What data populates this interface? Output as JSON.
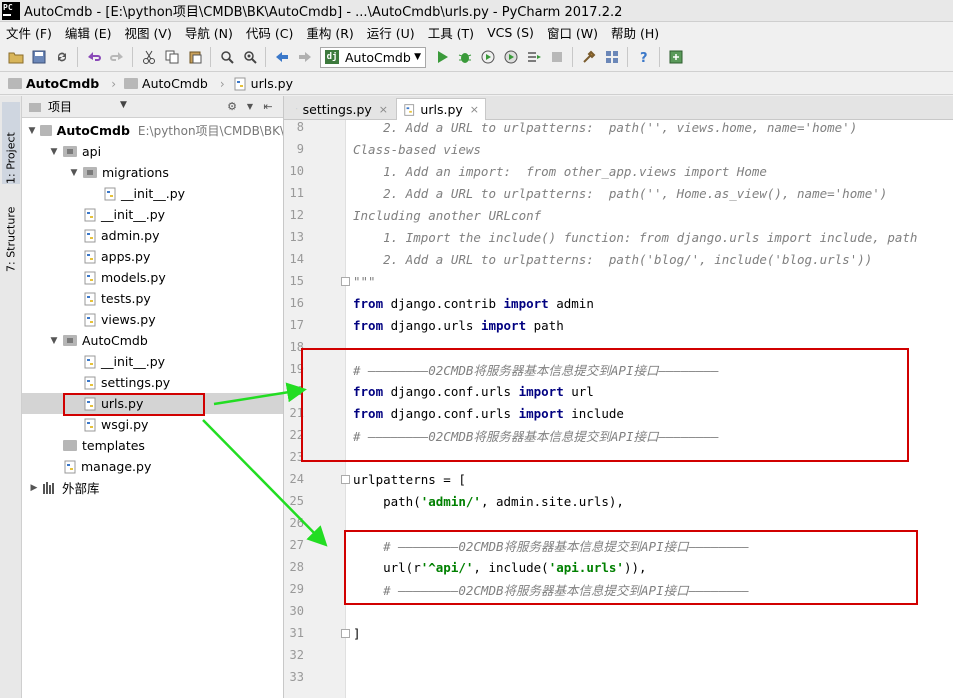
{
  "window": {
    "app_logo": "PC",
    "title": "AutoCmdb - [E:\\python项目\\CMDB\\BK\\AutoCmdb] - ...\\AutoCmdb\\urls.py - PyCharm 2017.2.2"
  },
  "menu": [
    "文件 (F)",
    "编辑 (E)",
    "视图 (V)",
    "导航 (N)",
    "代码 (C)",
    "重构 (R)",
    "运行 (U)",
    "工具 (T)",
    "VCS (S)",
    "窗口 (W)",
    "帮助 (H)"
  ],
  "toolbar": {
    "run_config": "AutoCmdb",
    "dj_label": "dj"
  },
  "breadcrumb": [
    "AutoCmdb",
    "AutoCmdb",
    "urls.py"
  ],
  "side_tabs": {
    "project": "1: Project",
    "structure": "7: Structure"
  },
  "project_panel": {
    "title": "项目",
    "root_path": "E:\\python项目\\CMDB\\BK\\",
    "tree": [
      {
        "label": "AutoCmdb",
        "depth": 0,
        "type": "folder",
        "open": true,
        "bold": true
      },
      {
        "label": "api",
        "depth": 1,
        "type": "package",
        "open": true
      },
      {
        "label": "migrations",
        "depth": 2,
        "type": "package",
        "open": true
      },
      {
        "label": "__init__.py",
        "depth": 3,
        "type": "py"
      },
      {
        "label": "__init__.py",
        "depth": 2,
        "type": "py"
      },
      {
        "label": "admin.py",
        "depth": 2,
        "type": "py"
      },
      {
        "label": "apps.py",
        "depth": 2,
        "type": "py"
      },
      {
        "label": "models.py",
        "depth": 2,
        "type": "py"
      },
      {
        "label": "tests.py",
        "depth": 2,
        "type": "py"
      },
      {
        "label": "views.py",
        "depth": 2,
        "type": "py"
      },
      {
        "label": "AutoCmdb",
        "depth": 1,
        "type": "package",
        "open": true
      },
      {
        "label": "__init__.py",
        "depth": 2,
        "type": "py"
      },
      {
        "label": "settings.py",
        "depth": 2,
        "type": "py"
      },
      {
        "label": "urls.py",
        "depth": 2,
        "type": "py",
        "selected": true
      },
      {
        "label": "wsgi.py",
        "depth": 2,
        "type": "py"
      },
      {
        "label": "templates",
        "depth": 1,
        "type": "folder"
      },
      {
        "label": "manage.py",
        "depth": 1,
        "type": "py"
      },
      {
        "label": "外部库",
        "depth": 0,
        "type": "lib",
        "open": false
      }
    ]
  },
  "tabs": [
    {
      "label": "settings.py",
      "active": false
    },
    {
      "label": "urls.py",
      "active": true
    }
  ],
  "code_lines": [
    {
      "n": "8",
      "segs": [
        {
          "t": "    2. Add a URL to urlpatterns:  path('', views.home, name='home')",
          "c": "cm"
        }
      ]
    },
    {
      "n": "9",
      "segs": [
        {
          "t": "Class-based views",
          "c": "cm"
        }
      ]
    },
    {
      "n": "10",
      "segs": [
        {
          "t": "    1. Add an import:  from other_app.views import Home",
          "c": "cm"
        }
      ]
    },
    {
      "n": "11",
      "segs": [
        {
          "t": "    2. Add a URL to urlpatterns:  path('', Home.as_view(), name='home')",
          "c": "cm"
        }
      ]
    },
    {
      "n": "12",
      "segs": [
        {
          "t": "Including another URLconf",
          "c": "cm"
        }
      ]
    },
    {
      "n": "13",
      "segs": [
        {
          "t": "    1. Import the include() function: from django.urls import include, path",
          "c": "cm"
        }
      ]
    },
    {
      "n": "14",
      "segs": [
        {
          "t": "    2. Add a URL to urlpatterns:  path('blog/', include('blog.urls'))",
          "c": "cm"
        }
      ]
    },
    {
      "n": "15",
      "segs": [
        {
          "t": "\"\"\"",
          "c": "cm"
        }
      ],
      "fold": true
    },
    {
      "n": "16",
      "segs": [
        {
          "t": "from",
          "c": "kw"
        },
        {
          "t": " django.contrib ",
          "c": ""
        },
        {
          "t": "import",
          "c": "kw"
        },
        {
          "t": " admin",
          "c": ""
        }
      ]
    },
    {
      "n": "17",
      "segs": [
        {
          "t": "from",
          "c": "kw"
        },
        {
          "t": " django.urls ",
          "c": ""
        },
        {
          "t": "import",
          "c": "kw"
        },
        {
          "t": " path",
          "c": ""
        }
      ]
    },
    {
      "n": "18",
      "segs": []
    },
    {
      "n": "19",
      "segs": [
        {
          "t": "# ————————02CMDB将服务器基本信息提交到API接口————————",
          "c": "cm"
        }
      ]
    },
    {
      "n": "20",
      "segs": [
        {
          "t": "from",
          "c": "kw"
        },
        {
          "t": " django.conf.urls ",
          "c": ""
        },
        {
          "t": "import",
          "c": "kw"
        },
        {
          "t": " url",
          "c": ""
        }
      ]
    },
    {
      "n": "21",
      "segs": [
        {
          "t": "from",
          "c": "kw"
        },
        {
          "t": " django.conf.urls ",
          "c": ""
        },
        {
          "t": "import",
          "c": "kw"
        },
        {
          "t": " include",
          "c": ""
        }
      ]
    },
    {
      "n": "22",
      "segs": [
        {
          "t": "# ————————02CMDB将服务器基本信息提交到API接口————————",
          "c": "cm"
        }
      ]
    },
    {
      "n": "23",
      "segs": []
    },
    {
      "n": "24",
      "segs": [
        {
          "t": "urlpatterns = [",
          "c": ""
        }
      ],
      "fold": true
    },
    {
      "n": "25",
      "segs": [
        {
          "t": "    path(",
          "c": ""
        },
        {
          "t": "'admin/'",
          "c": "str"
        },
        {
          "t": ", admin.site.urls),",
          "c": ""
        }
      ]
    },
    {
      "n": "26",
      "segs": []
    },
    {
      "n": "27",
      "segs": [
        {
          "t": "    # ————————02CMDB将服务器基本信息提交到API接口————————",
          "c": "cm"
        }
      ]
    },
    {
      "n": "28",
      "segs": [
        {
          "t": "    url(r",
          "c": ""
        },
        {
          "t": "'^api/'",
          "c": "str"
        },
        {
          "t": ", include(",
          "c": ""
        },
        {
          "t": "'api.urls'",
          "c": "str"
        },
        {
          "t": ")),",
          "c": ""
        }
      ]
    },
    {
      "n": "29",
      "segs": [
        {
          "t": "    # ————————02CMDB将服务器基本信息提交到API接口————————",
          "c": "cm"
        }
      ]
    },
    {
      "n": "30",
      "segs": []
    },
    {
      "n": "31",
      "segs": [
        {
          "t": "]",
          "c": ""
        }
      ],
      "fold": true
    },
    {
      "n": "32",
      "segs": []
    },
    {
      "n": "33",
      "segs": []
    }
  ],
  "colors": {
    "highlight_box": "#d10000",
    "arrow": "#22dd22"
  }
}
